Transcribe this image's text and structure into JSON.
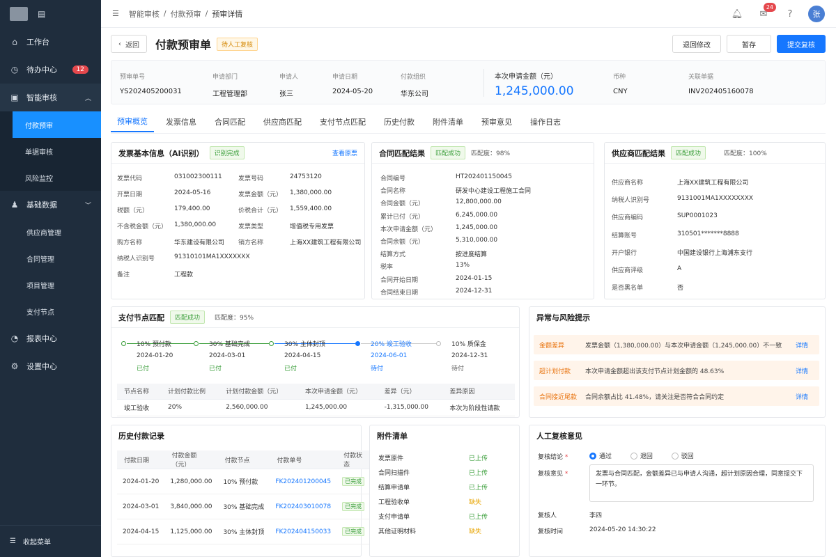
{
  "sidebar": {
    "collapse_label": "收起菜单",
    "items": [
      {
        "label": "工作台"
      },
      {
        "label": "待办中心",
        "badge": "12"
      },
      {
        "label": "智能审核"
      },
      {
        "label": "基础数据"
      },
      {
        "label": "报表中心"
      },
      {
        "label": "设置中心"
      }
    ],
    "audit_sub": [
      "付款预审",
      "单据审核",
      "风险监控"
    ],
    "data_sub": [
      "供应商管理",
      "合同管理",
      "项目管理",
      "支付节点"
    ]
  },
  "breadcrumb": [
    "智能审核",
    "付款预审",
    "预审详情"
  ],
  "topbar": {
    "notice_count": "24",
    "avatar": "张"
  },
  "header": {
    "back": "返回",
    "title": "付款预审单",
    "status": "待人工复核",
    "btn_return": "退回修改",
    "btn_save": "暂存",
    "btn_submit": "提交复核"
  },
  "info": [
    {
      "label": "预审单号",
      "value": "YS202405200031"
    },
    {
      "label": "申请部门",
      "value": "工程管理部"
    },
    {
      "label": "申请人",
      "value": "张三"
    },
    {
      "label": "申请日期",
      "value": "2024-05-20"
    },
    {
      "label": "付款组织",
      "value": "华东公司"
    },
    {
      "label": "本次申请金额（元）",
      "value": "1,245,000.00"
    },
    {
      "label": "币种",
      "value": "CNY"
    },
    {
      "label": "关联单据",
      "value": "INV202405160078"
    }
  ],
  "tabs": [
    "预审概览",
    "发票信息",
    "合同匹配",
    "供应商匹配",
    "支付节点匹配",
    "历史付款",
    "附件清单",
    "预审意见",
    "操作日志"
  ],
  "invoice": {
    "title": "发票基本信息（AI识别）",
    "badge": "识别完成",
    "link": "查看原票",
    "rows": [
      [
        "发票代码",
        "031002300111",
        "发票号码",
        "24753120"
      ],
      [
        "开票日期",
        "2024-05-16",
        "发票金额（元）",
        "1,380,000.00"
      ],
      [
        "税额（元）",
        "179,400.00",
        "价税合计（元）",
        "1,559,400.00"
      ],
      [
        "不含税金额（元）",
        "1,380,000.00",
        "发票类型",
        "增值税专用发票"
      ],
      [
        "购方名称",
        "华东建设有限公司",
        "销方名称",
        "上海XX建筑工程有限公司"
      ],
      [
        "纳税人识别号",
        "91310101MA1XXXXXXX",
        "",
        ""
      ],
      [
        "备注",
        "工程款",
        "",
        ""
      ]
    ]
  },
  "contract": {
    "title": "合同匹配结果",
    "badge": "匹配成功",
    "score": "匹配度：98%",
    "rows": [
      [
        "合同编号",
        "HT202401150045"
      ],
      [
        "合同名称",
        "研发中心建设工程施工合同"
      ],
      [
        "合同金额（元）",
        "12,800,000.00"
      ],
      [
        "累计已付（元）",
        "6,245,000.00"
      ],
      [
        "本次申请金额（元）",
        "1,245,000.00"
      ],
      [
        "合同余额（元）",
        "5,310,000.00"
      ],
      [
        "结算方式",
        "按进度结算"
      ],
      [
        "税率",
        "13%"
      ],
      [
        "合同开始日期",
        "2024-01-15"
      ],
      [
        "合同结束日期",
        "2024-12-31"
      ]
    ]
  },
  "supplier": {
    "title": "供应商匹配结果",
    "badge": "匹配成功",
    "score": "匹配度：100%",
    "rows": [
      [
        "供应商名称",
        "上海XX建筑工程有限公司"
      ],
      [
        "纳税人识别号",
        "9131001MA1XXXXXXXX"
      ],
      [
        "供应商编码",
        "SUP0001023"
      ],
      [
        "结算账号",
        "310501*******8888"
      ],
      [
        "开户银行",
        "中国建设银行上海浦东支行"
      ],
      [
        "供应商评级",
        "A"
      ],
      [
        "是否黑名单",
        "否"
      ]
    ]
  },
  "nodes": {
    "title": "支付节点匹配",
    "badge": "匹配成功",
    "score": "匹配度：95%",
    "steps": [
      {
        "t": "10% 预付款",
        "d": "2024-01-20",
        "s": "已付",
        "state": "done"
      },
      {
        "t": "30% 基础完成",
        "d": "2024-03-01",
        "s": "已付",
        "state": "done"
      },
      {
        "t": "30% 主体封顶",
        "d": "2024-04-15",
        "s": "已付",
        "state": "done"
      },
      {
        "t": "20% 竣工验收",
        "d": "2024-06-01",
        "s": "待付",
        "state": "cur"
      },
      {
        "t": "10% 质保金",
        "d": "2024-12-31",
        "s": "待付",
        "state": "pend"
      }
    ],
    "headers": [
      "节点名称",
      "计划付款比例",
      "计划付款金额（元）",
      "本次申请金额（元）",
      "差异（元）",
      "差异原因"
    ],
    "row": [
      "竣工验收",
      "20%",
      "2,560,000.00",
      "1,245,000.00",
      "-1,315,000.00",
      "本次为阶段性请款"
    ]
  },
  "risk": {
    "title": "异常与风险提示",
    "items": [
      {
        "t": "金额差异",
        "d": "发票金额（1,380,000.00）与本次申请金额（1,245,000.00）不一致",
        "l": "详情"
      },
      {
        "t": "超计划付款",
        "d": "本次申请金额超出该支付节点计划金额的 48.63%",
        "l": "详情"
      },
      {
        "t": "合同接近尾款",
        "d": "合同余额占比 41.48%，请关注是否符合合同约定",
        "l": "详情"
      }
    ]
  },
  "history": {
    "title": "历史付款记录",
    "headers": [
      "付款日期",
      "付款金额（元）",
      "付款节点",
      "付款单号",
      "付款状态"
    ],
    "rows": [
      [
        "2024-01-20",
        "1,280,000.00",
        "10% 预付款",
        "FK202401200045",
        "已完成"
      ],
      [
        "2024-03-01",
        "3,840,000.00",
        "30% 基础完成",
        "FK202403010078",
        "已完成"
      ],
      [
        "2024-04-15",
        "1,125,000.00",
        "30% 主体封顶",
        "FK202404150033",
        "已完成"
      ]
    ]
  },
  "attach": {
    "title": "附件清单",
    "rows": [
      [
        "发票原件",
        "已上传"
      ],
      [
        "合同扫描件",
        "已上传"
      ],
      [
        "结算申请单",
        "已上传"
      ],
      [
        "工程验收单",
        "缺失"
      ],
      [
        "支付申请单",
        "已上传"
      ],
      [
        "其他证明材料",
        "缺失"
      ]
    ]
  },
  "review": {
    "title": "人工复核意见",
    "conclusion_label": "复核结论",
    "options": [
      "通过",
      "退回",
      "驳回"
    ],
    "opinion_label": "复核意见",
    "opinion": "发票与合同匹配，金额差异已与申请人沟通，超计划原因合理，同意提交下一环节。",
    "reviewer_label": "复核人",
    "reviewer": "李四",
    "time_label": "复核时间",
    "time": "2024-05-20 14:30:22"
  }
}
